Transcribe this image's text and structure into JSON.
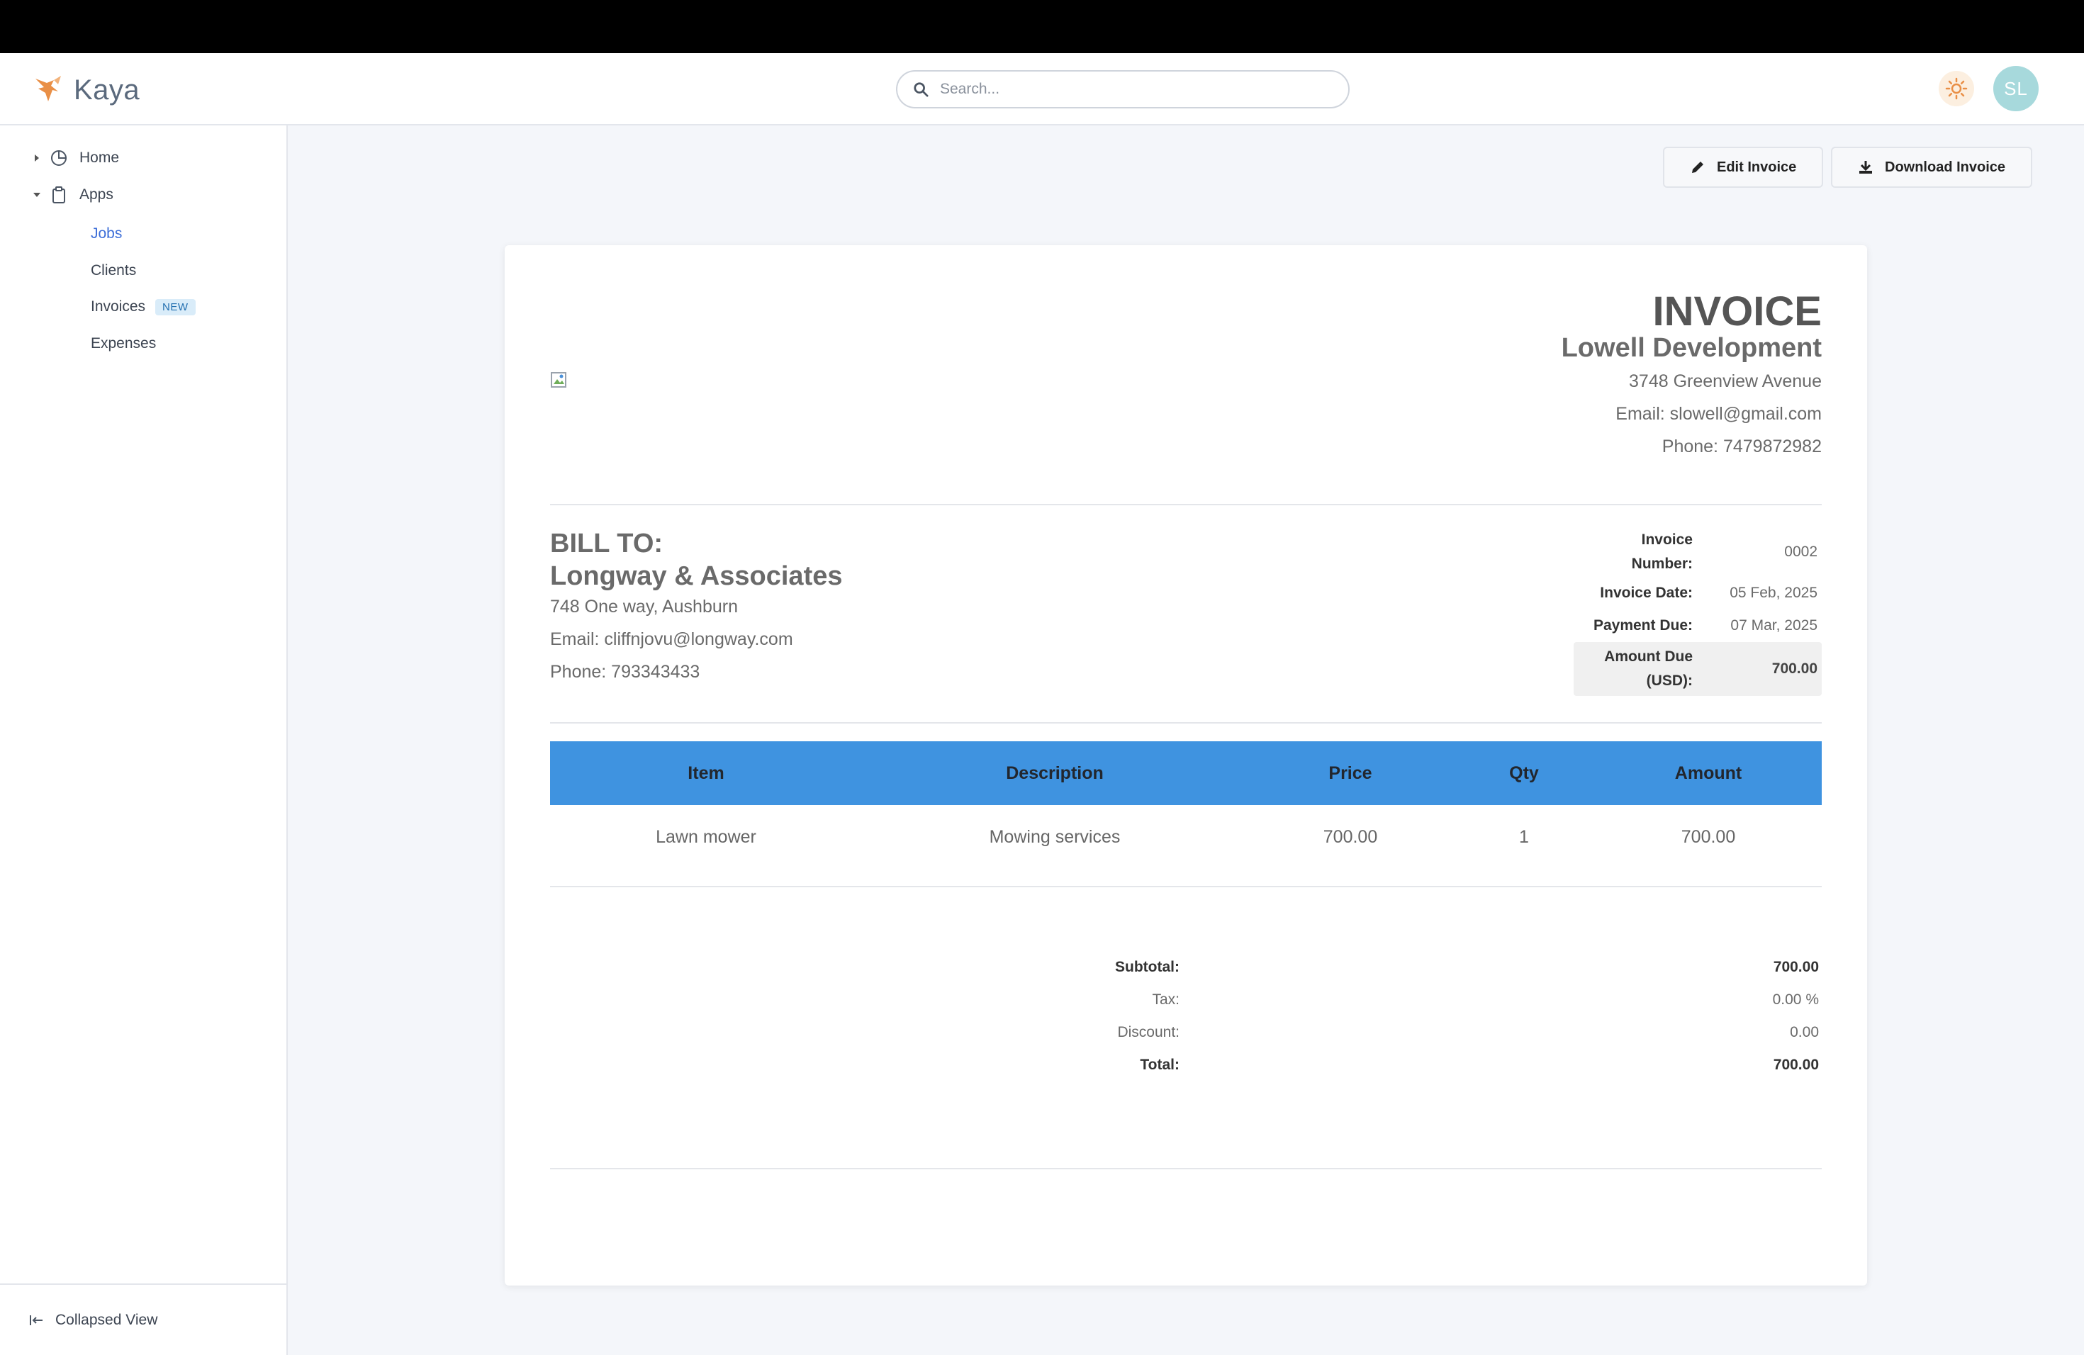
{
  "app": {
    "name": "Kaya",
    "brand_color": "#e98f46"
  },
  "header": {
    "search_placeholder": "Search...",
    "avatar_initials": "SL"
  },
  "sidebar": {
    "items": [
      {
        "label": "Home",
        "icon": "pie-chart-icon",
        "expanded": false
      },
      {
        "label": "Apps",
        "icon": "clipboard-icon",
        "expanded": true
      }
    ],
    "subitems": [
      {
        "label": "Jobs",
        "active": true
      },
      {
        "label": "Clients"
      },
      {
        "label": "Invoices",
        "badge": "NEW"
      },
      {
        "label": "Expenses"
      }
    ],
    "footer_label": "Collapsed View"
  },
  "actions": {
    "edit_label": "Edit Invoice",
    "download_label": "Download Invoice"
  },
  "invoice": {
    "title": "INVOICE",
    "from": {
      "company": "Lowell Development",
      "address": "3748 Greenview Avenue",
      "email": "Email: slowell@gmail.com",
      "phone": "Phone: 7479872982"
    },
    "bill_to": {
      "label": "BILL TO:",
      "company": "Longway & Associates",
      "address": "748 One way, Aushburn",
      "email": "Email: cliffnjovu@longway.com",
      "phone": "Phone: 793343433"
    },
    "meta": {
      "number_label_1": "Invoice",
      "number_label_2": "Number:",
      "number": "0002",
      "date_label": "Invoice Date:",
      "date": "05 Feb, 2025",
      "due_label": "Payment Due:",
      "due": "07 Mar, 2025",
      "amount_label_1": "Amount Due",
      "amount_label_2": "(USD):",
      "amount": "700.00"
    },
    "table": {
      "headers": [
        "Item",
        "Description",
        "Price",
        "Qty",
        "Amount"
      ],
      "rows": [
        [
          "Lawn mower",
          "Mowing services",
          "700.00",
          "1",
          "700.00"
        ]
      ]
    },
    "totals": {
      "subtotal_label": "Subtotal:",
      "subtotal": "700.00",
      "tax_label": "Tax:",
      "tax": "0.00 %",
      "discount_label": "Discount:",
      "discount": "0.00",
      "total_label": "Total:",
      "total": "700.00"
    }
  }
}
